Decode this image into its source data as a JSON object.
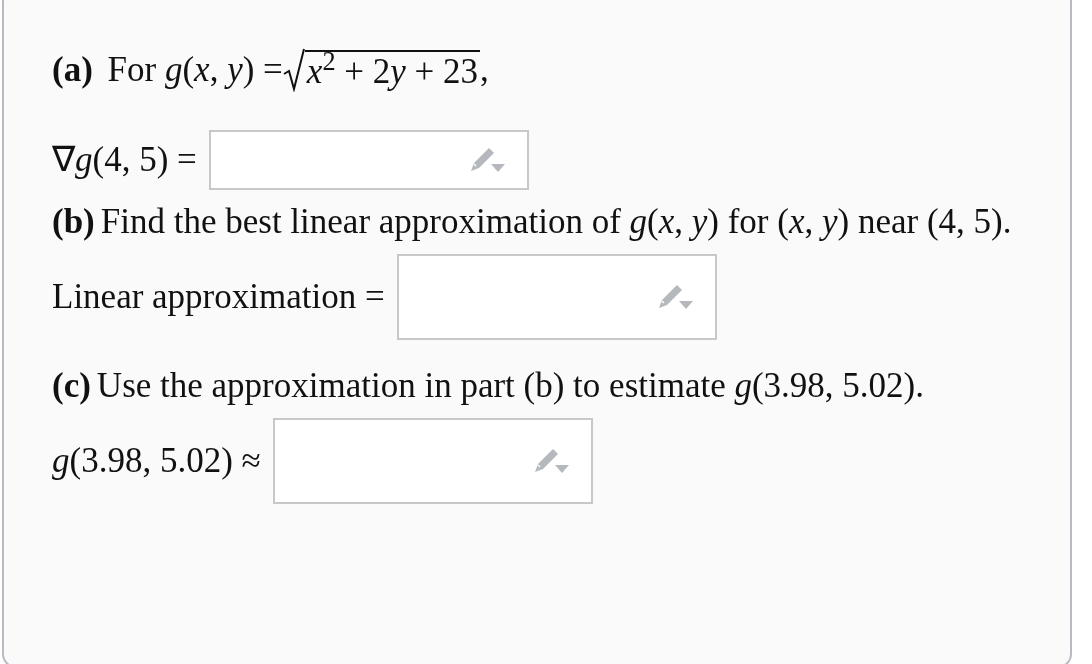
{
  "parts": [
    {
      "heading": "(a)",
      "prompt": [
        {
          "kind": "text",
          "text": "For *g*(*x*, *y*) ="
        },
        {
          "kind": "sqrt",
          "pieces": [
            "*x*$^{2}$ + 2",
            "*y*",
            "+ 23"
          ]
        },
        {
          "kind": "text",
          "text": ","
        }
      ],
      "answer": {
        "label": "∇*g*(4, 5) ="
      }
    },
    {
      "heading": "(b)",
      "prompt": [
        {
          "kind": "text",
          "text": "Find the best linear approximation of *g*(*x*, *y*) for (*x*, *y*) near (4, 5)."
        }
      ],
      "answer": {
        "label": "Linear approximation ="
      }
    },
    {
      "heading": "(c)",
      "prompt": [
        {
          "kind": "text",
          "text": "Use the approximation in part (b) to estimate *g*(3.98, 5.02)."
        }
      ],
      "answer": {
        "label": "*g*(3.98, 5.02) ≈"
      }
    }
  ]
}
